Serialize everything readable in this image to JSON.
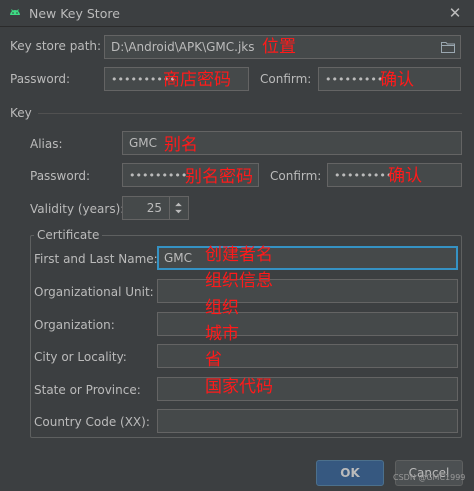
{
  "window": {
    "title": "New Key Store",
    "close_glyph": "✕"
  },
  "keystore": {
    "path_label": "Key store path:",
    "path_value": "D:\\Android\\APK\\GMC.jks",
    "path_note": "位置",
    "password_label": "Password:",
    "password_value": "••••••••••",
    "password_note": "商店密码",
    "confirm_label": "Confirm:",
    "confirm_value": "•••••••••",
    "confirm_note": "确认"
  },
  "key": {
    "section_label": "Key",
    "alias_label": "Alias:",
    "alias_value": "GMC",
    "alias_note": "别名",
    "password_label": "Password:",
    "password_value": "•••••••••",
    "password_note": "别名密码",
    "confirm_label": "Confirm:",
    "confirm_value": "•••••••••",
    "confirm_note": "确认",
    "validity_label": "Validity (years):",
    "validity_value": "25"
  },
  "certificate": {
    "group_label": "Certificate",
    "fields": [
      {
        "label": "First and Last Name:",
        "value": "GMC",
        "note": "创建者名"
      },
      {
        "label": "Organizational Unit:",
        "value": "",
        "note": "组织信息"
      },
      {
        "label": "Organization:",
        "value": "",
        "note": "组织"
      },
      {
        "label": "City or Locality:",
        "value": "",
        "note": "城市"
      },
      {
        "label": "State or Province:",
        "value": "",
        "note": "省"
      },
      {
        "label": "Country Code (XX):",
        "value": "",
        "note": "国家代码"
      }
    ]
  },
  "buttons": {
    "ok": "OK",
    "cancel": "Cancel"
  },
  "watermark": "CSDN @GMC1999",
  "colors": {
    "accent_focus": "#3592c4",
    "annotation": "#ff1a1a",
    "ok_button": "#365880"
  }
}
